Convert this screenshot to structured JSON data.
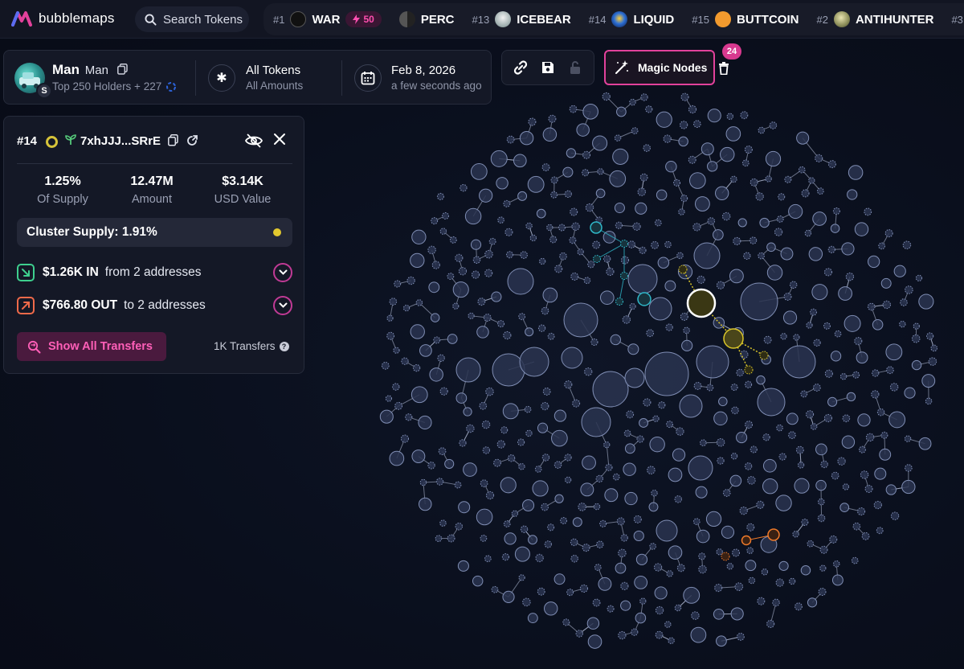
{
  "app": {
    "name": "bubblemaps",
    "brand_color": "#e2419b"
  },
  "search": {
    "label": "Search Tokens",
    "icon": "search-icon"
  },
  "ticker": [
    {
      "rank": "#1",
      "symbol": "WAR",
      "boost": "50",
      "icon_color": "#ffffff"
    },
    {
      "rank": "",
      "symbol": "PERC",
      "icon_color": "#8b8b8b"
    },
    {
      "rank": "#13",
      "symbol": "ICEBEAR",
      "icon_color": "#d7d7d7"
    },
    {
      "rank": "#14",
      "symbol": "LIQUID",
      "icon_color": "#2c6fd6"
    },
    {
      "rank": "#15",
      "symbol": "BUTTCOIN",
      "icon_color": "#f29a2e"
    },
    {
      "rank": "#2",
      "symbol": "ANTIHUNTER",
      "icon_color": "#b8b07a"
    },
    {
      "rank": "#3",
      "symbol": "",
      "icon_color": "#2b2b2b"
    }
  ],
  "token": {
    "name": "Man",
    "ticker": "Man",
    "holders": "Top 250 Holders + 227",
    "chain_badge": "S"
  },
  "filter": {
    "title": "All Tokens",
    "subtitle": "All Amounts"
  },
  "date": {
    "title": "Feb 8, 2026",
    "subtitle": "a few seconds ago"
  },
  "tools": {
    "magic_label": "Magic Nodes",
    "magic_count": "24"
  },
  "wallet": {
    "rank": "#14",
    "address": "7xhJJJ...SRrE",
    "stats": [
      {
        "value": "1.25%",
        "label": "Of Supply"
      },
      {
        "value": "12.47M",
        "label": "Amount"
      },
      {
        "value": "$3.14K",
        "label": "USD Value"
      }
    ],
    "cluster": "Cluster Supply: 1.91%",
    "cluster_color": "#e2c82e",
    "inflow": {
      "amount": "$1.26K IN",
      "text": "from 2 addresses",
      "color": "#3ecf8e"
    },
    "outflow": {
      "amount": "$766.80 OUT",
      "text": "to 2 addresses",
      "color": "#f06a4a"
    },
    "show_transfers": "Show All Transfers",
    "transfers": "1K Transfers"
  },
  "map": {
    "node_fill": "#2a3450",
    "node_stroke": "#7f8db3",
    "selected_color": "#d9c52a",
    "teal_color": "#2fb8c9",
    "orange_color": "#ef7a2a"
  }
}
